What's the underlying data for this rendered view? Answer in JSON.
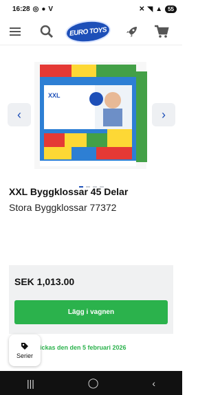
{
  "status": {
    "time": "16:28",
    "battery": "55"
  },
  "header": {
    "menu_icon": "menu-icon",
    "search_icon": "search-icon",
    "logo_text": "EURO TOYS",
    "rocket_icon": "rocket-icon",
    "cart_icon": "cart-icon"
  },
  "gallery": {
    "slides": 4,
    "active": 1
  },
  "product": {
    "title": "XXL Byggklossar 45 Delar",
    "subtitle": "Stora Byggklossar 77372",
    "price": "SEK 1,013.00",
    "add_to_cart": "Lägg i vagnen",
    "shipping": "kickas den den 5 februari 2026"
  },
  "serier": {
    "label": "Serier"
  },
  "colors": {
    "brand": "#1d4fb8",
    "green": "#2bb24c"
  }
}
